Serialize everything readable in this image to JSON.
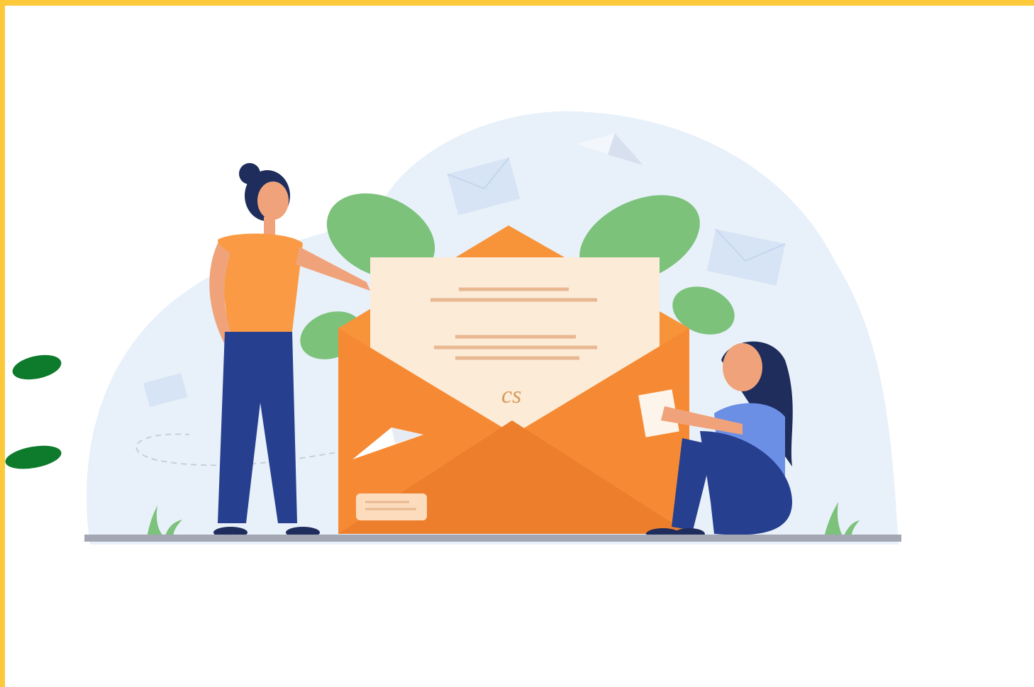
{
  "frame": {
    "border_color": "#fcc93a",
    "background": "#ffffff"
  },
  "illustration": {
    "subject": "mail-envelope-illustration",
    "colors": {
      "blob": "#e8f0f9",
      "envelope": "#f7943a",
      "envelope_dark": "#ed7f2c",
      "letter": "#fcebd7",
      "leaf": "#7cc27b",
      "skin": "#f0a37a",
      "hair": "#1f2d5c",
      "pants": "#263f8f",
      "shirt_left": "#fb9a44",
      "shirt_right": "#6c8fe6",
      "ground": "#a2a7b3",
      "accent_leaf": "#0e7a2c"
    },
    "signature_text": "cs"
  }
}
